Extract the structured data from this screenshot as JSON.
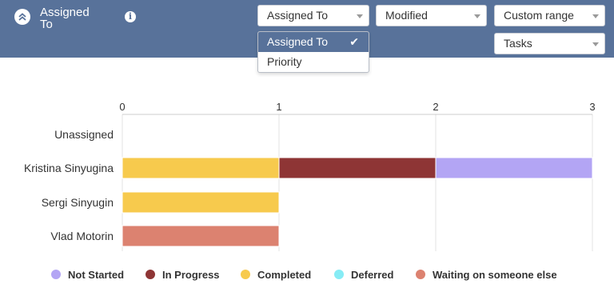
{
  "header": {
    "title": "Assigned To",
    "collapse_icon": "double-chevron-up-icon",
    "info_icon": "info-icon",
    "info_glyph": "i"
  },
  "filters": {
    "group_by": {
      "value": "Assigned To"
    },
    "date_field": {
      "value": "Modified"
    },
    "date_range": {
      "value": "Custom range"
    },
    "item_type": {
      "value": "Tasks"
    }
  },
  "group_by_dropdown": {
    "open": true,
    "options": [
      {
        "label": "Assigned To",
        "selected": true
      },
      {
        "label": "Priority",
        "selected": false
      }
    ]
  },
  "chart_data": {
    "type": "bar",
    "orientation": "horizontal",
    "stacked": true,
    "categories": [
      "Unassigned",
      "Kristina Sinyugina",
      "Sergi Sinyugin",
      "Vlad Motorin"
    ],
    "series": [
      {
        "name": "Not Started",
        "color": "#b3a5f4",
        "values": [
          0,
          1,
          0,
          0
        ]
      },
      {
        "name": "In Progress",
        "color": "#8e3535",
        "values": [
          0,
          1,
          0,
          0
        ]
      },
      {
        "name": "Completed",
        "color": "#f7ca4d",
        "values": [
          0,
          1,
          1,
          0
        ]
      },
      {
        "name": "Deferred",
        "color": "#86ecf5",
        "values": [
          0,
          0,
          0,
          0
        ]
      },
      {
        "name": "Waiting on someone else",
        "color": "#dc8270",
        "values": [
          0,
          0,
          0,
          1
        ]
      }
    ],
    "stack_order": [
      "Completed",
      "In Progress",
      "Not Started",
      "Deferred",
      "Waiting on someone else"
    ],
    "x_ticks": [
      "0",
      "1",
      "2",
      "3"
    ],
    "xlim": [
      0,
      3
    ],
    "x_axis_position": "top",
    "grid": true,
    "legend_position": "bottom"
  }
}
